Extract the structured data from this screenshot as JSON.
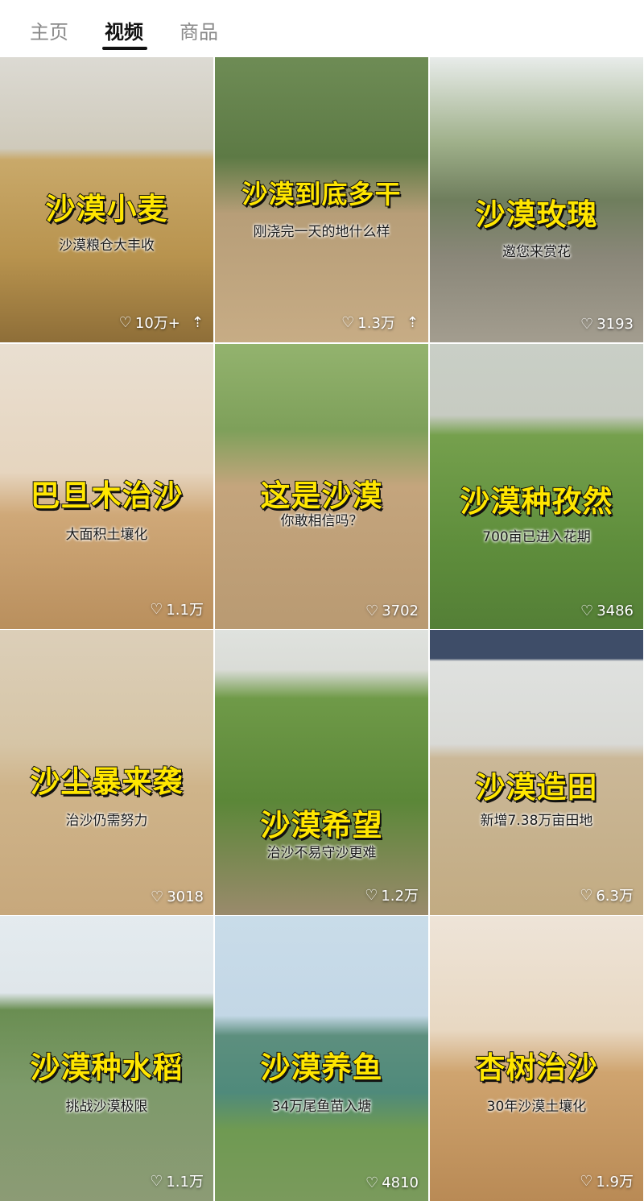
{
  "tabs": [
    {
      "label": "主页",
      "active": false
    },
    {
      "label": "视频",
      "active": true
    },
    {
      "label": "商品",
      "active": false
    }
  ],
  "icons": {
    "like": "heart-outline-icon",
    "pinned": "pin-top-icon"
  },
  "accent": {
    "title_fill": "#ffe600",
    "title_stroke": "#111111"
  },
  "videos": [
    {
      "title": "沙漠小麦",
      "subtitle": "沙漠粮仓大丰收",
      "likes": "10万+",
      "pinned": true
    },
    {
      "title": "沙漠到底多干",
      "subtitle": "刚浇完一天的地什么样",
      "likes": "1.3万",
      "pinned": true
    },
    {
      "title": "沙漠玫瑰",
      "subtitle": "邀您来赏花",
      "likes": "3193",
      "pinned": false
    },
    {
      "title": "巴旦木治沙",
      "subtitle": "大面积土壤化",
      "likes": "1.1万",
      "pinned": false
    },
    {
      "title": "这是沙漠",
      "subtitle": "你敢相信吗？",
      "likes": "3702",
      "pinned": false
    },
    {
      "title": "沙漠种孜然",
      "subtitle": "700亩已进入花期",
      "likes": "3486",
      "pinned": false
    },
    {
      "title": "沙尘暴来袭",
      "subtitle": "治沙仍需努力",
      "likes": "3018",
      "pinned": false
    },
    {
      "title": "沙漠希望",
      "subtitle": "治沙不易守沙更难",
      "likes": "1.2万",
      "pinned": false
    },
    {
      "title": "沙漠造田",
      "subtitle": "新增7.38万亩田地",
      "likes": "6.3万",
      "pinned": false
    },
    {
      "title": "沙漠种水稻",
      "subtitle": "挑战沙漠极限",
      "likes": "1.1万",
      "pinned": false
    },
    {
      "title": "沙漠养鱼",
      "subtitle": "34万尾鱼苗入塘",
      "likes": "4810",
      "pinned": false
    },
    {
      "title": "杏树治沙",
      "subtitle": "30年沙漠土壤化",
      "likes": "1.9万",
      "pinned": false
    }
  ]
}
